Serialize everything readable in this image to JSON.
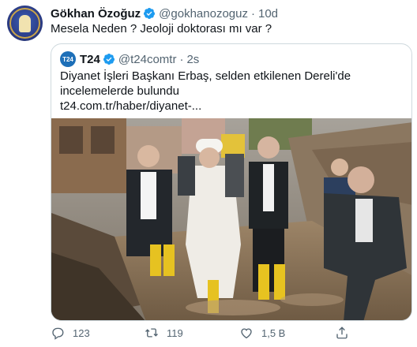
{
  "tweet": {
    "author_name": "Gökhan Özoğuz",
    "handle": "@gokhanozoguz",
    "separator": "·",
    "time": "10d",
    "text": "Mesela Neden ? Jeoloji doktorası mı var ?"
  },
  "quote": {
    "avatar_text": "T24",
    "name": "T24",
    "handle": "@t24comtr",
    "separator": "·",
    "time": "2s",
    "text": "Diyanet İşleri Başkanı Erbaş, selden etkilenen Dereli'de incelemelerde bulundu",
    "link": "t24.com.tr/haber/diyanet-..."
  },
  "actions": {
    "reply_count": "123",
    "retweet_count": "119",
    "like_count": "1,5 B"
  },
  "icons": [
    "verified-badge-icon",
    "reply-icon",
    "retweet-icon",
    "like-icon",
    "share-icon"
  ],
  "colors": {
    "verified": "#1d9bf0",
    "secondary_text": "#536471",
    "border": "#cfd9de",
    "brand_t24": "#1d6fb8"
  }
}
